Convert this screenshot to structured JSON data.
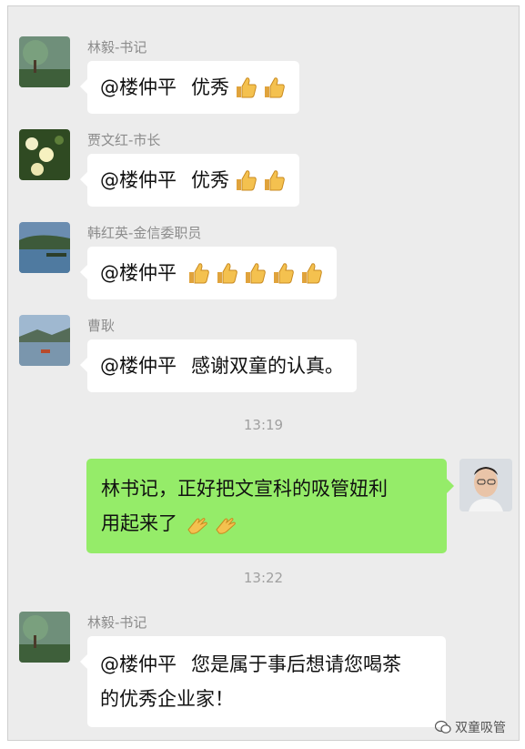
{
  "messages": [
    {
      "sender": "林毅-书记",
      "mention": "@楼仲平",
      "text": "优秀",
      "emoji_count": 2
    },
    {
      "sender": "贾文红-市长",
      "mention": "@楼仲平",
      "text": "优秀",
      "emoji_count": 2
    },
    {
      "sender": "韩红英-金信委职员",
      "mention": "@楼仲平",
      "text": "",
      "emoji_count": 5
    },
    {
      "sender": "曹耿",
      "mention": "@楼仲平",
      "text": "感谢双童的认真。",
      "emoji_count": 0
    }
  ],
  "timestamp_1": "13:19",
  "own_message": {
    "line1": "林书记，正好把文宣科的吸管妞利",
    "line2": "用起来了"
  },
  "timestamp_2": "13:22",
  "last_message": {
    "sender": "林毅-书记",
    "mention": "@楼仲平",
    "line1": "您是属于事后想请您喝茶",
    "line2": "的优秀企业家！"
  },
  "watermark": "双童吸管",
  "icons": {
    "thumbs_up": "thumbs-up-icon",
    "clap": "clap-hands-icon",
    "wechat": "wechat-icon"
  },
  "colors": {
    "background": "#ececec",
    "self_bubble": "#95ec69",
    "other_bubble": "#ffffff"
  }
}
